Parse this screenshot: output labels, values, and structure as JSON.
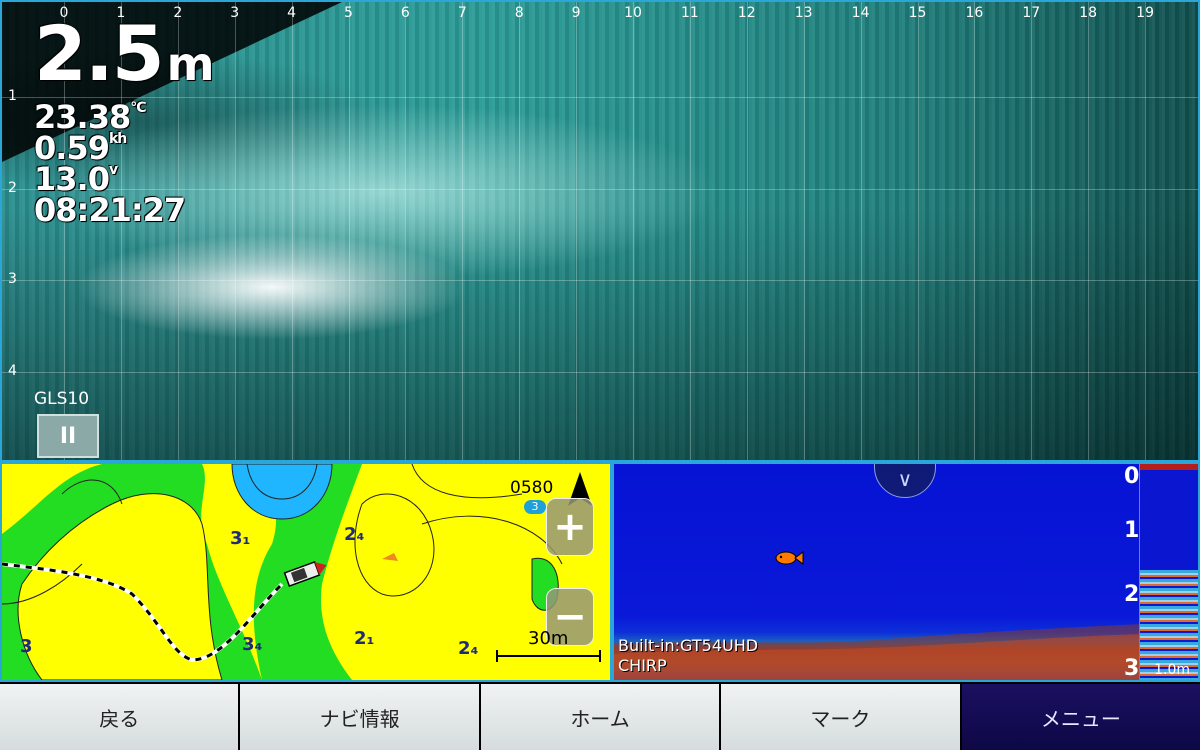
{
  "sonar": {
    "depth_value": "2.5",
    "depth_unit": "m",
    "water_temp": "23.38",
    "water_temp_unit": "°C",
    "speed": "0.59",
    "speed_unit": "kh",
    "voltage": "13.0",
    "voltage_unit": "v",
    "time": "08:21:27",
    "source": "GLS10",
    "pause_label": "II",
    "x_ticks": [
      "0",
      "1",
      "2",
      "3",
      "4",
      "5",
      "6",
      "7",
      "8",
      "9",
      "10",
      "11",
      "12",
      "13",
      "14",
      "15",
      "16",
      "17",
      "18",
      "19"
    ],
    "y_ticks": [
      "1",
      "2",
      "3",
      "4"
    ],
    "colors": {
      "water": "#2a9b96",
      "frame": "#2aa7d8"
    }
  },
  "chart": {
    "target_label": "0580",
    "waypoint_badge": "3",
    "zoom_in_label": "+",
    "zoom_out_label": "−",
    "scale_label": "30m",
    "contours": [
      "3₁",
      "2₄",
      "3",
      "3₄",
      "2₁",
      "2₄"
    ],
    "colors": {
      "shallow": "#ffff00",
      "mid": "#22dd22",
      "deep": "#1fb6ff"
    }
  },
  "echo": {
    "depth_ticks": [
      "0",
      "1",
      "2",
      "3"
    ],
    "source_line1": "Built-in:GT54UHD",
    "source_line2": "CHIRP",
    "scale_value": "1.0m",
    "chevron_icon": "double-chevron-down-icon"
  },
  "toolbar": {
    "back": "戻る",
    "nav_info": "ナビ情報",
    "home": "ホーム",
    "mark": "マーク",
    "menu": "メニュー"
  }
}
